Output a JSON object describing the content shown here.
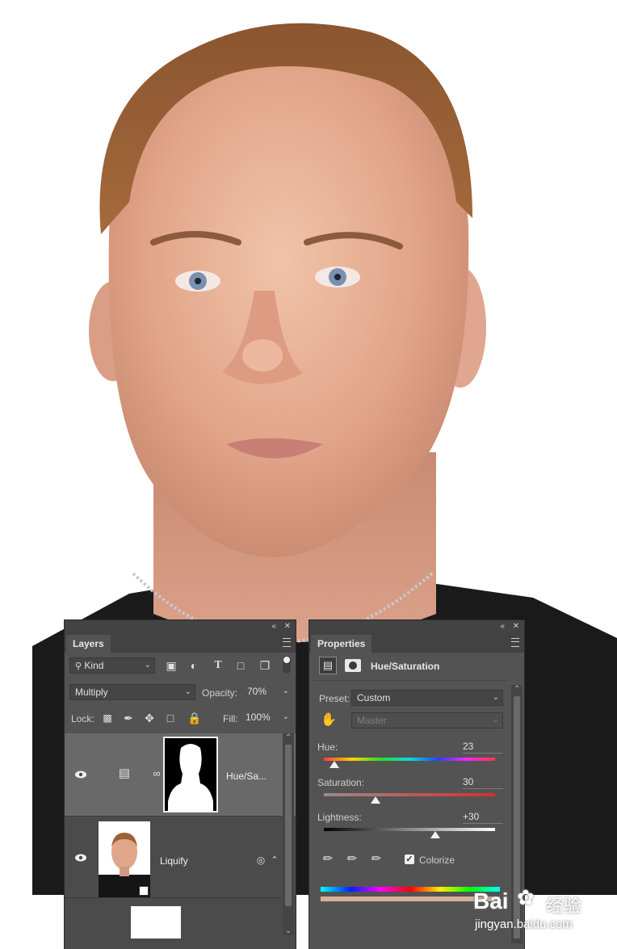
{
  "layers_panel": {
    "tab_label": "Layers",
    "filter_kind": "Kind",
    "blend_mode": "Multiply",
    "opacity_label": "Opacity:",
    "opacity_value": "70%",
    "lock_label": "Lock:",
    "fill_label": "Fill:",
    "fill_value": "100%",
    "layers": [
      {
        "name": "Hue/Sa...",
        "selected": true
      },
      {
        "name": "Liquify",
        "selected": false
      },
      {
        "name": "",
        "selected": false
      }
    ]
  },
  "properties_panel": {
    "tab_label": "Properties",
    "adjustment_title": "Hue/Saturation",
    "preset_label": "Preset:",
    "preset_value": "Custom",
    "channel_value": "Master",
    "hue_label": "Hue:",
    "hue_value": "23",
    "saturation_label": "Saturation:",
    "saturation_value": "30",
    "lightness_label": "Lightness:",
    "lightness_value": "+30",
    "colorize_label": "Colorize",
    "colorize_checked": true,
    "slider_positions": {
      "hue": 0.06,
      "saturation": 0.3,
      "lightness": 0.65
    }
  },
  "watermark": {
    "logo_text": "Bai",
    "logo_cn": "经验",
    "url": "jingyan.baidu.com"
  },
  "colors": {
    "panel_bg": "#535353",
    "panel_dark": "#434343",
    "selected_layer": "#696969",
    "colorize_bar": "#d6b09a"
  }
}
